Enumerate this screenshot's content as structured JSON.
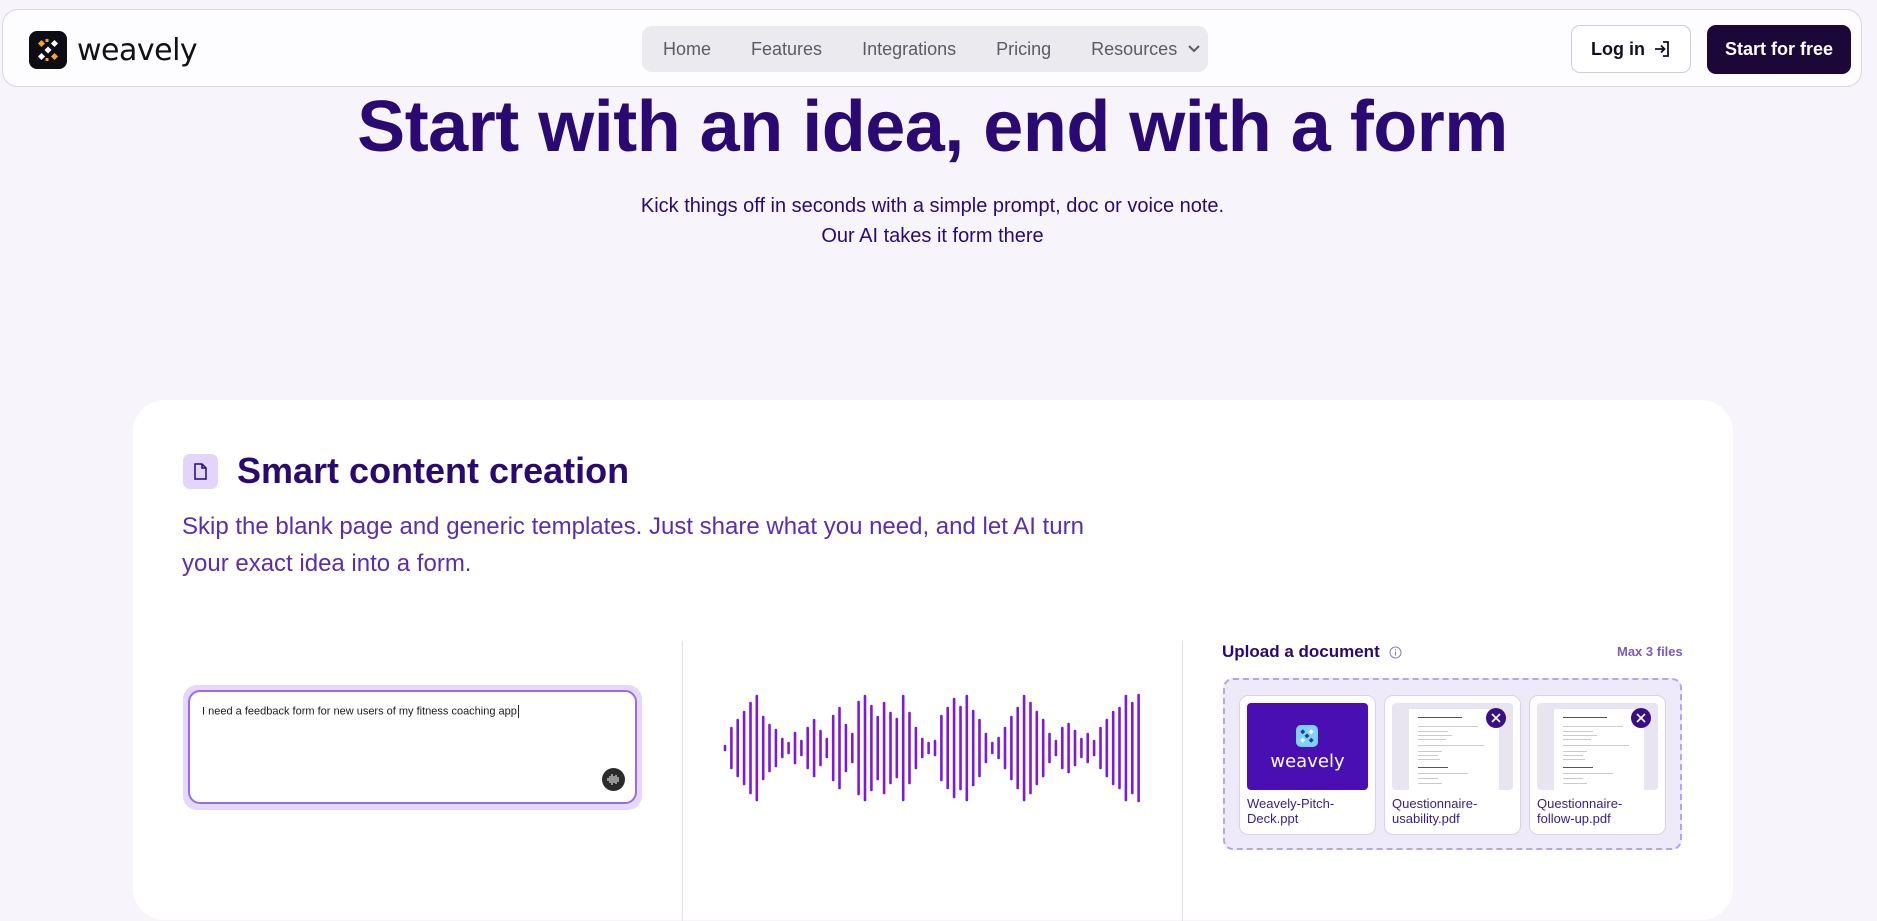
{
  "nav": {
    "logo_text": "weavely",
    "menu": [
      {
        "label": "Home"
      },
      {
        "label": "Features"
      },
      {
        "label": "Integrations"
      },
      {
        "label": "Pricing"
      },
      {
        "label": "Resources"
      }
    ],
    "login_label": "Log in",
    "start_label": "Start for free"
  },
  "hero": {
    "title": "Start with an idea, end with a form",
    "subtitle_line1": "Kick things off in seconds with a simple prompt, doc or voice note.",
    "subtitle_line2": "Our AI takes it form there"
  },
  "feature": {
    "title": "Smart content creation",
    "description": "Skip the blank page and generic templates. Just share what you need, and let AI turn your exact idea into a form.",
    "prompt_value": "I need a feedback form for new users of my fitness coaching app",
    "upload_title": "Upload a document",
    "max_files": "Max 3 files",
    "files": [
      {
        "name_line1": "Weavely-Pitch-",
        "name_line2": "Deck.ppt",
        "thumb_text": "weavely"
      },
      {
        "name_line1": "Questionnaire-",
        "name_line2": "usability.pdf"
      },
      {
        "name_line1": "Questionnaire-",
        "name_line2": "follow-up.pdf"
      }
    ]
  },
  "colors": {
    "brand_dark": "#1c0838",
    "heading": "#2a0a72",
    "accent": "#7a18e8",
    "background": "#f7f5fb"
  },
  "icons": [
    "logo-icon",
    "chevron-down-icon",
    "login-arrow-icon",
    "document-icon",
    "microphone-icon",
    "info-icon",
    "close-icon"
  ]
}
